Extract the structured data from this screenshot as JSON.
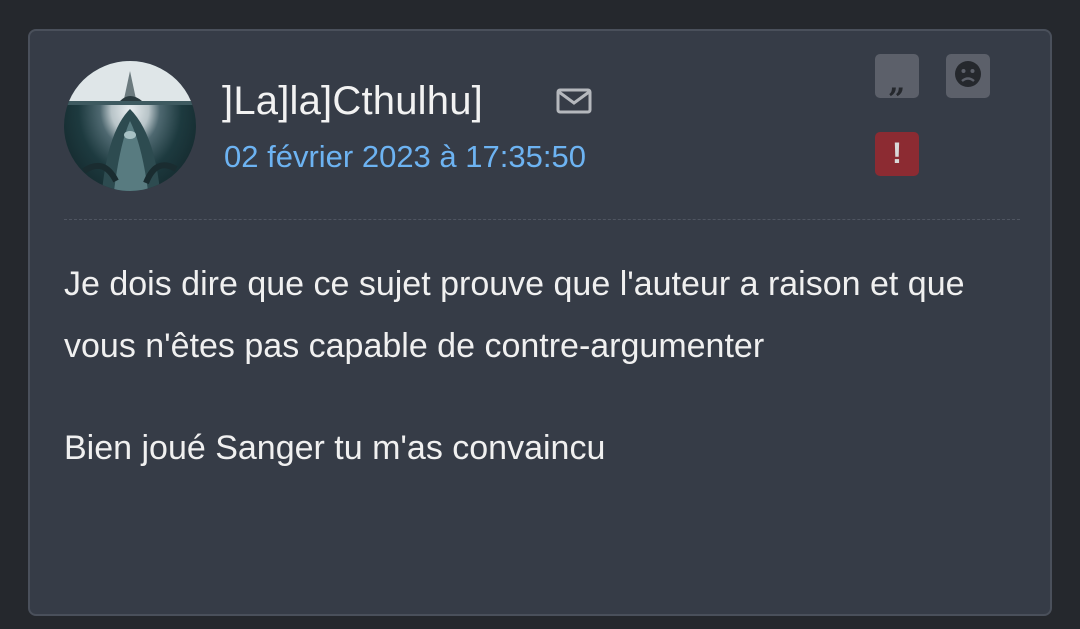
{
  "post": {
    "author": "]La]la]Cthulhu]",
    "date": "02 février 2023 à 17:35:50",
    "icons": {
      "mail": "mail-icon",
      "quote": "quote-icon",
      "sad": "sad-face-icon",
      "report": "exclamation-icon"
    },
    "buttons": {
      "quote_glyph": "„",
      "report_glyph": "!"
    },
    "paragraphs": [
      "Je dois dire que ce sujet prouve que l'auteur a raison et que vous n'êtes pas capable de contre-argumenter",
      "Bien joué Sanger tu m'as convaincu"
    ]
  },
  "colors": {
    "page_background": "#25282d",
    "card_background": "#363c47",
    "date_link": "#6db3f2",
    "report_button": "#8c2b32",
    "action_button": "#5c606a"
  }
}
